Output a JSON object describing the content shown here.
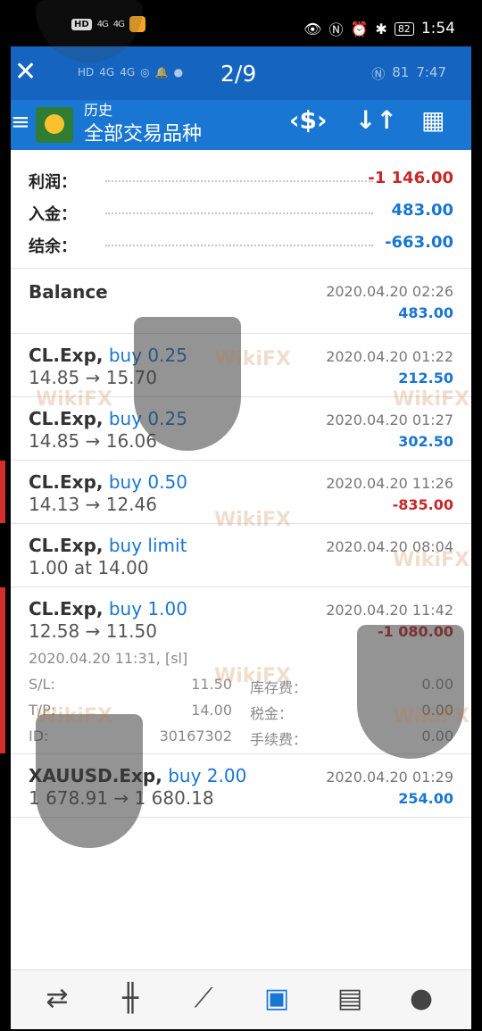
{
  "status_bar": {
    "network": "HD",
    "signal1": "4G",
    "signal2": "4G",
    "battery": "82",
    "time": "1:54"
  },
  "viewer": {
    "close_icon": "close-icon",
    "page_counter": "2/9",
    "inner_battery": "81",
    "inner_time": "7:47"
  },
  "toolbar": {
    "subtitle": "历史",
    "title": "全部交易品种",
    "menu_icon": "menu-icon",
    "icons": [
      "currency-exchange-icon",
      "sort-icon",
      "calendar-icon"
    ]
  },
  "summary": [
    {
      "label": "利润：",
      "value": "-1 146.00",
      "color": "#c62828"
    },
    {
      "label": "入金：",
      "value": "483.00",
      "color": "#1976d2"
    },
    {
      "label": "结余：",
      "value": "-663.00",
      "color": "#1976d2"
    }
  ],
  "trades": [
    {
      "symbol": "Balance",
      "action": "",
      "prices": "",
      "date": "2020.04.20 02:26",
      "profit": "483.00",
      "profit_color": "#1976d2"
    },
    {
      "symbol": "CL.Exp,",
      "action": " buy 0.25",
      "prices": "14.85 → 15.70",
      "date": "2020.04.20 01:22",
      "profit": "212.50",
      "profit_color": "#1976d2"
    },
    {
      "symbol": "CL.Exp,",
      "action": " buy 0.25",
      "prices": "14.85 → 16.06",
      "date": "2020.04.20 01:27",
      "profit": "302.50",
      "profit_color": "#1976d2"
    },
    {
      "symbol": "CL.Exp,",
      "action": " buy 0.50",
      "prices": "14.13 → 12.46",
      "date": "2020.04.20 11:26",
      "profit": "-835.00",
      "profit_color": "#c62828"
    },
    {
      "symbol": "CL.Exp,",
      "action": " buy limit",
      "prices": "1.00 at 14.00",
      "date": "2020.04.20 08:04",
      "profit": "",
      "profit_color": "#1976d2"
    },
    {
      "symbol": "CL.Exp,",
      "action": " buy 1.00",
      "prices": "12.58 → 11.50",
      "date": "2020.04.20 11:42",
      "profit": "-1 080.00",
      "profit_color": "#c62828"
    },
    {
      "symbol": "XAUUSD.Exp,",
      "action": " buy 2.00",
      "prices": "1 678.91 → 1 680.18",
      "date": "2020.04.20 01:29",
      "profit": "254.00",
      "profit_color": "#1976d2"
    }
  ],
  "detail": {
    "open_time": "2020.04.20 11:31, [sl]",
    "rows": [
      {
        "k1": "S/L:",
        "v1": "11.50",
        "k2": "库存费：",
        "v2": "0.00"
      },
      {
        "k1": "T/P:",
        "v1": "14.00",
        "k2": "税金：",
        "v2": "0.00"
      },
      {
        "k1": "ID:",
        "v1": "30167302",
        "k2": "手续费：",
        "v2": "0.00"
      }
    ]
  },
  "bottom_nav": [
    {
      "icon": "quotes-icon",
      "glyph": "⇄"
    },
    {
      "icon": "chart-icon",
      "glyph": "╫"
    },
    {
      "icon": "trade-icon",
      "glyph": "⟋"
    },
    {
      "icon": "history-icon",
      "glyph": "▣"
    },
    {
      "icon": "news-icon",
      "glyph": "▤"
    },
    {
      "icon": "chat-icon",
      "glyph": "●"
    }
  ],
  "watermark": "WikiFX"
}
